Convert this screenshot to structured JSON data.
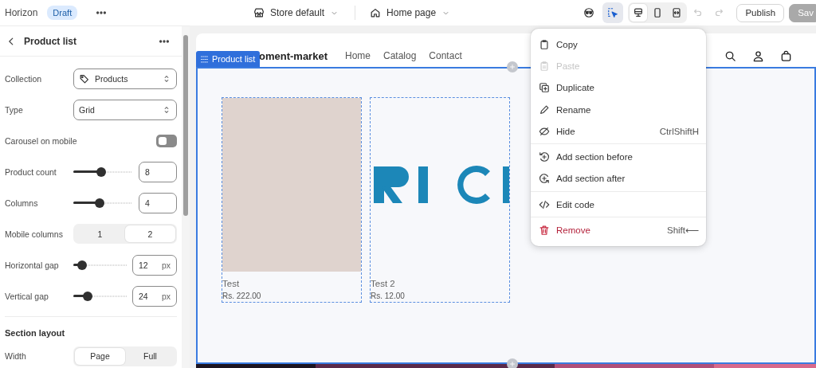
{
  "topbar": {
    "theme_name": "Horizon",
    "status_badge": "Draft",
    "store_selector": "Store default",
    "page_selector": "Home page",
    "tools": [
      {
        "kind": "preview",
        "selected": false
      },
      {
        "kind": "inspector",
        "selected": true
      }
    ],
    "view_modes": [
      {
        "kind": "desktop",
        "selected": true
      },
      {
        "kind": "mobile",
        "selected": false
      },
      {
        "kind": "fullwidth",
        "selected": false
      }
    ],
    "history": [
      {
        "kind": "undo",
        "disabled": true
      },
      {
        "kind": "redo",
        "disabled": true
      }
    ],
    "buttons": [
      {
        "label": "Publish",
        "disabled": false
      },
      {
        "label": "Sav",
        "disabled": true
      }
    ]
  },
  "panel": {
    "title": "Product list",
    "settings": [
      {
        "kind": "select",
        "label": "Collection",
        "value": "Products",
        "has_icon": true
      },
      {
        "kind": "select",
        "label": "Type",
        "value": "Grid",
        "has_icon": false
      },
      {
        "kind": "toggle",
        "label": "Carousel on mobile",
        "on": false
      },
      {
        "kind": "slider",
        "label": "Product count",
        "level": 0.47,
        "value": "8"
      },
      {
        "kind": "slider",
        "label": "Columns",
        "level": 0.45,
        "value": "4"
      },
      {
        "kind": "segmented",
        "label": "Mobile columns",
        "options": [
          {
            "label": "1",
            "selected": false
          },
          {
            "label": "2",
            "selected": true
          }
        ]
      },
      {
        "kind": "slider",
        "label": "Horizontal gap",
        "level": 0.16,
        "value": "12",
        "unit": "px"
      },
      {
        "kind": "slider",
        "label": "Vertical gap",
        "level": 0.26,
        "value": "24",
        "unit": "px"
      },
      {
        "kind": "heading",
        "label": "Section layout"
      },
      {
        "kind": "segmented",
        "label": "Width",
        "options": [
          {
            "label": "Page",
            "selected": true
          },
          {
            "label": "Full",
            "selected": false
          }
        ]
      }
    ]
  },
  "preview": {
    "section_tag": "Product list",
    "store_name": "oment-market",
    "nav": [
      "Home",
      "Catalog",
      "Contact"
    ],
    "products": [
      {
        "kind": "plain",
        "name": "Test",
        "price": "Rs. 222.00"
      },
      {
        "kind": "picture",
        "name": "Test 2",
        "price": "Rs. 12.00"
      }
    ]
  },
  "context_menu": {
    "groups": [
      [
        {
          "kind": "copy",
          "label": "Copy",
          "disabled": false,
          "destructive": false
        },
        {
          "kind": "paste",
          "label": "Paste",
          "disabled": true,
          "destructive": false
        },
        {
          "kind": "duplicate",
          "label": "Duplicate",
          "disabled": false,
          "destructive": false
        },
        {
          "kind": "rename",
          "label": "Rename",
          "disabled": false,
          "destructive": false
        },
        {
          "kind": "hide",
          "label": "Hide",
          "shortcut": "CtrlShiftH",
          "disabled": false,
          "destructive": false
        }
      ],
      [
        {
          "kind": "add-before",
          "label": "Add section before",
          "disabled": false,
          "destructive": false
        },
        {
          "kind": "add-after",
          "label": "Add section after",
          "disabled": false,
          "destructive": false
        }
      ],
      [
        {
          "kind": "code",
          "label": "Edit code",
          "disabled": false,
          "destructive": false
        }
      ],
      [
        {
          "kind": "trash",
          "label": "Remove",
          "shortcut": "Shift⟵",
          "disabled": false,
          "destructive": true
        }
      ]
    ]
  }
}
